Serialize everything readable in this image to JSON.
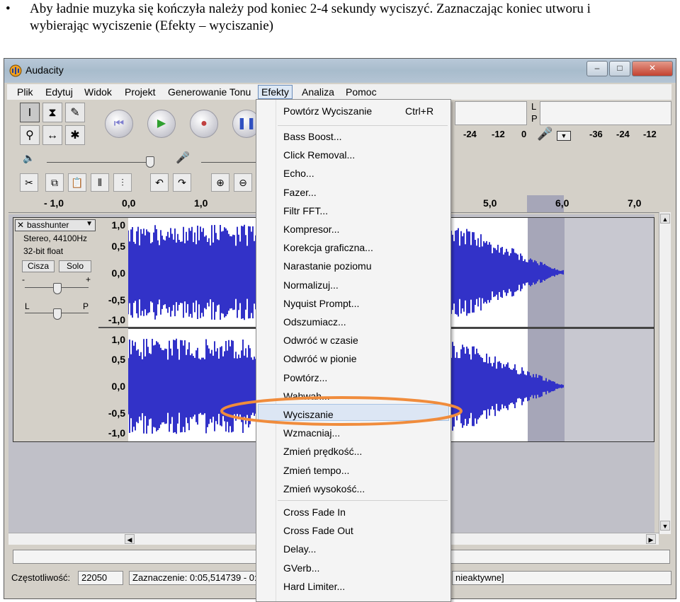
{
  "document": {
    "bullet": "•",
    "line1": "Aby ładnie muzyka się kończyła należy pod koniec 2-4 sekundy wyciszyć. Zaznaczając koniec utworu i",
    "line2": "wybierając wyciszenie (Efekty – wyciszanie)"
  },
  "window": {
    "title": "Audacity",
    "controls": {
      "minimize": "–",
      "maximize": "□",
      "close": "✕"
    }
  },
  "menubar": {
    "items": [
      "Plik",
      "Edytuj",
      "Widok",
      "Projekt",
      "Generowanie Tonu",
      "Efekty",
      "Analiza",
      "Pomoc"
    ],
    "active": "Efekty"
  },
  "meters": {
    "play_channels": [
      "L",
      "P"
    ],
    "play_scale": [
      "-24",
      "-12",
      "0"
    ],
    "rec_scale": [
      "-36",
      "-24",
      "-12"
    ]
  },
  "slider_labels": {
    "left": "L",
    "right": "P",
    "minus": "-",
    "plus": "+"
  },
  "ruler": {
    "labels": [
      "- 1,0",
      "0,0",
      "1,0",
      "5,0",
      "6,0",
      "7,0"
    ]
  },
  "tracks": [
    {
      "close": "✕",
      "name": "basshunter",
      "dropdown": "▼",
      "info1": "Stereo, 44100Hz",
      "info2": "32-bit float",
      "mute": "Cisza",
      "solo": "Solo",
      "scale": [
        "1,0",
        "0,5",
        "0,0",
        "-0,5",
        "-1,0"
      ]
    },
    {
      "scale": [
        "1,0",
        "0,5",
        "0,0",
        "-0,5",
        "-1,0"
      ]
    }
  ],
  "statusbar": {
    "rate_label": "Częstotliwość:",
    "rate_value": "22050",
    "selection": "Zaznaczenie: 0:05,514739 - 0:",
    "right_text": "nieaktywne]"
  },
  "effects_menu": {
    "repeat": {
      "label": "Powtórz Wyciszanie",
      "shortcut": "Ctrl+R"
    },
    "group1": [
      "Bass Boost...",
      "Click Removal...",
      "Echo...",
      "Fazer...",
      "Filtr FFT...",
      "Kompresor...",
      "Korekcja graficzna...",
      "Narastanie poziomu",
      "Normalizuj...",
      "Nyquist Prompt...",
      "Odszumiacz...",
      "Odwróć w czasie",
      "Odwróć w pionie",
      "Powtórz...",
      "Wahwah...",
      "Wyciszanie",
      "Wzmacniaj...",
      "Zmień prędkość...",
      "Zmień tempo...",
      "Zmień wysokość..."
    ],
    "group2": [
      "Cross Fade In",
      "Cross Fade Out",
      "Delay...",
      "GVerb...",
      "Hard Limiter..."
    ],
    "highlighted": "Wyciszanie"
  },
  "colors": {
    "waveform": "#3232c8",
    "selection": "#a6a6b8",
    "annotation": "#f08c3c",
    "menu_highlight": "#dce6f4"
  },
  "icons": {
    "play": "play-icon",
    "stop": "stop-icon",
    "pause": "pause-icon",
    "skip_start": "skip-start-icon",
    "select_tool": "select-tool-icon",
    "envelope_tool": "envelope-tool-icon",
    "draw_tool": "pencil-icon",
    "zoom_tool": "zoom-tool-icon",
    "timeshift_tool": "timeshift-tool-icon",
    "multi_tool": "multi-tool-icon"
  }
}
